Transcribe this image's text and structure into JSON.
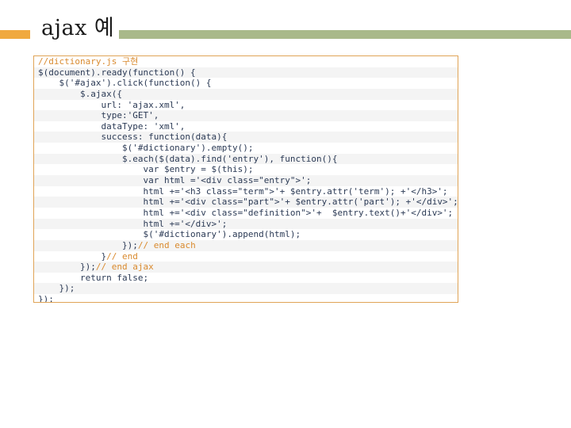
{
  "slide": {
    "title": "ajax 예"
  },
  "code": {
    "lines": [
      {
        "code": "",
        "comment": "//dictionary.js 구현"
      },
      {
        "code": "$(document).ready(function() {",
        "comment": ""
      },
      {
        "code": "    $('#ajax').click(function() {",
        "comment": ""
      },
      {
        "code": "        $.ajax({",
        "comment": ""
      },
      {
        "code": "            url: 'ajax.xml',",
        "comment": ""
      },
      {
        "code": "            type:'GET',",
        "comment": ""
      },
      {
        "code": "            dataType: 'xml',",
        "comment": ""
      },
      {
        "code": "            success: function(data){",
        "comment": ""
      },
      {
        "code": "                $('#dictionary').empty();",
        "comment": ""
      },
      {
        "code": "                $.each($(data).find('entry'), function(){",
        "comment": ""
      },
      {
        "code": "                    var $entry = $(this);",
        "comment": ""
      },
      {
        "code": "                    var html ='<div class=\"entry\">';",
        "comment": ""
      },
      {
        "code": "                    html +='<h3 class=\"term\">'+ $entry.attr('term'); +'</h3>';",
        "comment": ""
      },
      {
        "code": "                    html +='<div class=\"part\">'+ $entry.attr('part'); +'</div>';",
        "comment": ""
      },
      {
        "code": "                    html +='<div class=\"definition\">'+  $entry.text()+'</div>';",
        "comment": ""
      },
      {
        "code": "                    html +='</div>';",
        "comment": ""
      },
      {
        "code": "                    $('#dictionary').append(html);",
        "comment": ""
      },
      {
        "code": "                });",
        "comment": "// end each"
      },
      {
        "code": "            }",
        "comment": "// end"
      },
      {
        "code": "        });",
        "comment": "// end ajax"
      },
      {
        "code": "        return false;",
        "comment": ""
      },
      {
        "code": "    });",
        "comment": ""
      },
      {
        "code": "});",
        "comment": ""
      }
    ]
  }
}
